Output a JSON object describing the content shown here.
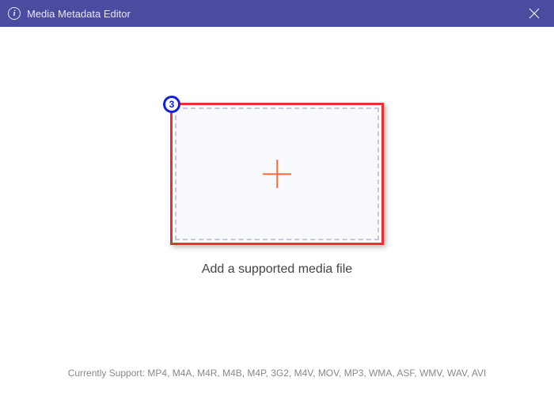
{
  "window": {
    "title": "Media Metadata Editor"
  },
  "step": {
    "number": "3"
  },
  "main": {
    "instruction": "Add a supported media file"
  },
  "footer": {
    "support_text": "Currently Support: MP4, M4A, M4R, M4B, M4P, 3G2, M4V, MOV, MP3, WMA, ASF, WMV, WAV, AVI"
  }
}
